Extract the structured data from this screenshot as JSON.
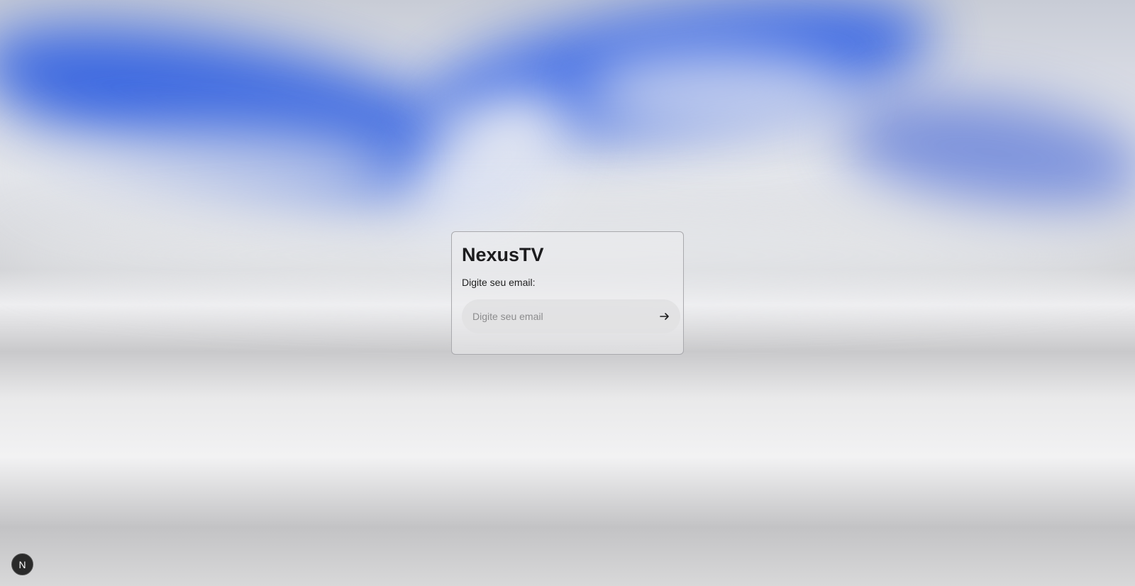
{
  "login": {
    "title": "NexusTV",
    "email_label": "Digite seu email:",
    "email_value": "",
    "email_placeholder": "Digite seu email",
    "submit_icon": "arrow-right-icon"
  },
  "dev_badge": {
    "letter": "N",
    "icon": "nextjs-logo-icon"
  },
  "colors": {
    "accent_blue": "#2f5fe0",
    "text_dark": "#1c1c1e",
    "placeholder": "#8c8c8e"
  }
}
